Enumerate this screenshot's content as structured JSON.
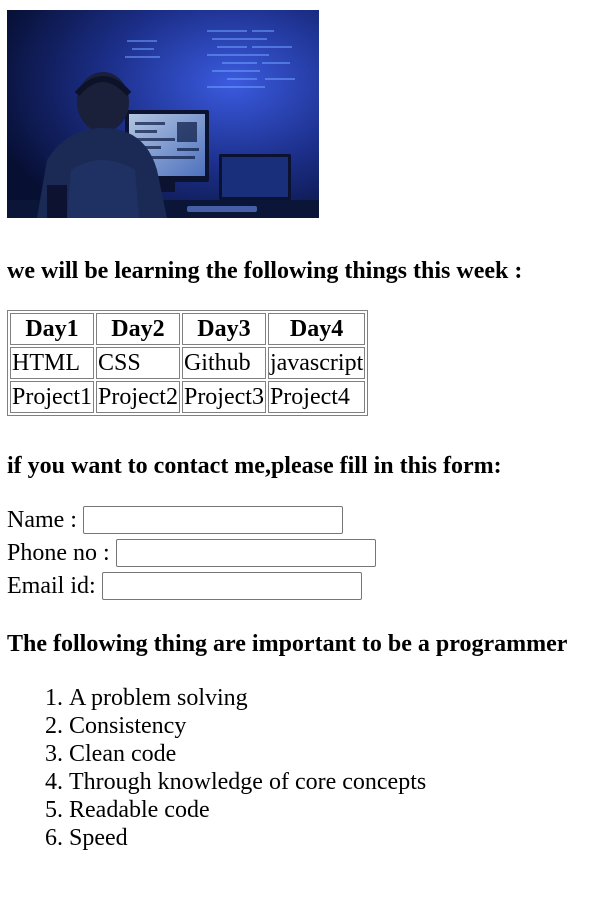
{
  "hero_image": {
    "icon": "programmer-at-computer-photo",
    "colors": {
      "background_dark": "#0a1a4a",
      "background_glow": "#2746c8",
      "screen_glow": "#7fb4ff",
      "person": "#1a2a55"
    }
  },
  "headings": {
    "learning": "we will be learning the following things this week :",
    "contact": "if you want to contact me,please fill in this form:",
    "important": "The following thing are important to be a programmer"
  },
  "schedule": {
    "headers": [
      "Day1",
      "Day2",
      "Day3",
      "Day4"
    ],
    "rows": [
      [
        "HTML",
        "CSS",
        "Github",
        "javascript"
      ],
      [
        "Project1",
        "Project2",
        "Project3",
        "Project4"
      ]
    ]
  },
  "form": {
    "fields": [
      {
        "label": "Name : ",
        "value": "",
        "placeholder": ""
      },
      {
        "label": "Phone no : ",
        "value": "",
        "placeholder": ""
      },
      {
        "label": "Email id: ",
        "value": "",
        "placeholder": ""
      }
    ]
  },
  "skills": [
    "A problem solving",
    "Consistency",
    "Clean code",
    "Through knowledge of core concepts",
    "Readable code",
    "Speed"
  ]
}
